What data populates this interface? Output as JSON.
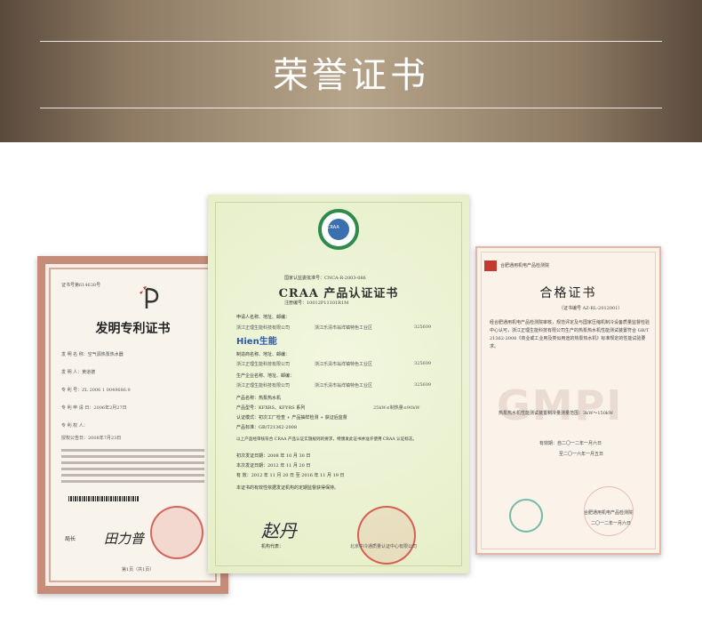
{
  "banner": {
    "title": "荣誉证书"
  },
  "patent": {
    "number": "证书号第614638号",
    "title": "发明专利证书",
    "fields": [
      "发  明  名  称：空气源热泵热水器",
      "发    明    人：黄道德",
      "专    利    号：ZL 2006 1 0049686.9",
      "专 利 申 请 日：2006年2月27日",
      "专  利  权  人：",
      "授权公告日：2008年7月23日"
    ],
    "chief_label": "局长",
    "signature": "田力普",
    "page": "第1页（共1页）"
  },
  "craa": {
    "badge_text": "CRAA",
    "reg_no": "国家认监委批准号：CNCA-R-2003-086",
    "title": "CRAA 产品认证证书",
    "cert_no": "注册编号：10012P11101R1M",
    "labels": {
      "applicant": "申请人名称、地址、邮编：",
      "manufacturer": "制造商名称、地址、邮编：",
      "factory": "生产企业名称、地址、邮编：",
      "product": "产品名称：热泵热水机",
      "model": "产品型号：KFXRS、KFYRS 系列",
      "mode": "认证模式：初次工厂检查 + 产品抽样检测 + 获证后监督",
      "standard": "产品标准：GB/T21362-2008",
      "statement": "以上产品经审核符合 CRAA 产品认证实施规则的要求，特颁发此证书并准许使用 CRAA 认证标志。",
      "first": "初次发证日期：2008 年 10 月 30 日",
      "issue": "本次发证日期：2012 年 11 月 20 日",
      "valid": "有    效：2012 年 11 月 20 日  至  2016 年 11 月 19 日",
      "note": "本证书的有效性依据发证机构的定期监督获得保持。",
      "org": "机构代表："
    },
    "company": "浙江正理生能科技有限公司",
    "address": "浙江乐清市翁垟镇特色工业区",
    "zip": "325609",
    "brand": "Hien生能",
    "capacity": "25kW≤制热量≤90kW",
    "signature": "赵丹",
    "issuer": "北京中冷通质量认证中心有限公司"
  },
  "gmpi": {
    "header_org": "合肥通用机电产品检测院",
    "code": "（证书编号 AZ-RL-2012001）",
    "title": "合格证书",
    "body": "经合肥通用机电产品检测院审核，规范评定及与国家压缩机制冷设备质量监督检验中心认可，浙江正理生能科技有限公司生产的热泵热水机性能测试装置符合 GB/T 21362-2008《商业或工业用及类似用途的热泵热水机》标准规定的性能试验要求。",
    "range": "热泵热水机性能测试装置制冷量测量范围：3kW～150kW",
    "valid_from": "有效期：自二〇一二年一月六日",
    "valid_to": "至二〇一六年一月五日",
    "watermark": "GMPI",
    "footer_org": "合肥通用机电产品检测院",
    "footer_date": "二〇一二年一月六日"
  }
}
